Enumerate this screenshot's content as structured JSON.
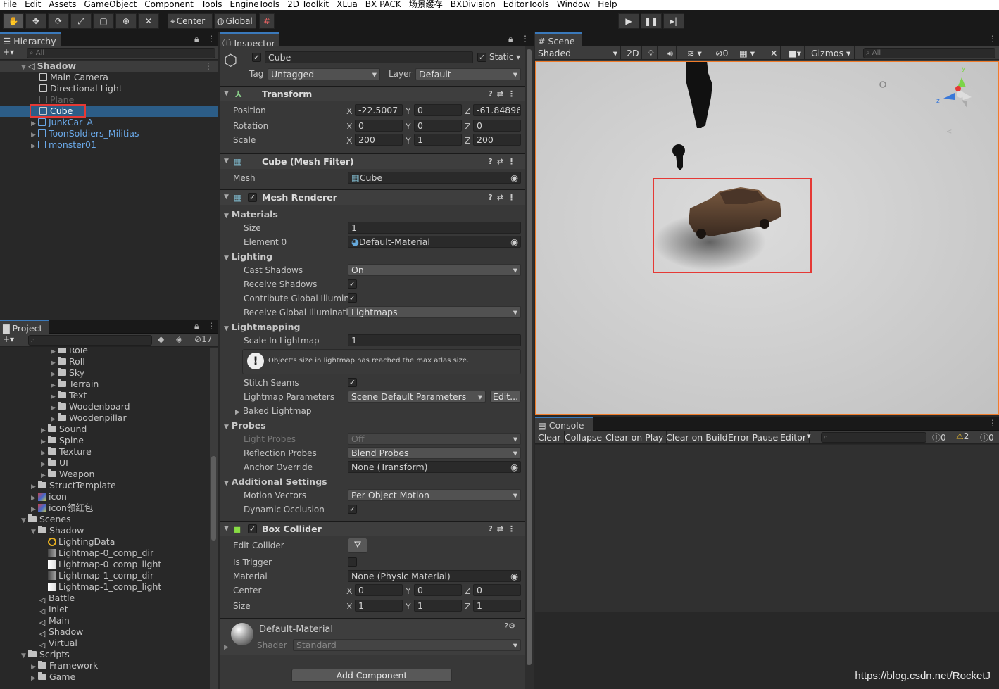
{
  "menubar": [
    "File",
    "Edit",
    "Assets",
    "GameObject",
    "Component",
    "Tools",
    "EngineTools",
    "2D Toolkit",
    "XLua",
    "BX PACK",
    "场景缓存",
    "BXDivision",
    "EditorTools",
    "Window",
    "Help"
  ],
  "toolbar": {
    "pivot_label": "Center",
    "space_label": "Global",
    "tool_icons": [
      "hand-icon",
      "move-icon",
      "rotate-icon",
      "scale-icon",
      "rect-icon",
      "transform-icon",
      "custom-tool-icon"
    ],
    "play_icons": [
      "play-icon",
      "pause-icon",
      "step-icon"
    ]
  },
  "hierarchy": {
    "tab": "Hierarchy",
    "search_placeholder": "All",
    "scene": "Shadow",
    "items": [
      {
        "label": "Main Camera",
        "state": "normal"
      },
      {
        "label": "Directional Light",
        "state": "normal"
      },
      {
        "label": "Plane",
        "state": "disabled"
      },
      {
        "label": "Cube",
        "state": "selected"
      },
      {
        "label": "JunkCar_A",
        "state": "prefab"
      },
      {
        "label": "ToonSoldiers_Militias",
        "state": "prefab"
      },
      {
        "label": "monster01",
        "state": "prefab"
      }
    ]
  },
  "project": {
    "tab": "Project",
    "hidden_count": "17",
    "items": [
      {
        "label": "Role",
        "indent": 3,
        "icon": "folder"
      },
      {
        "label": "Roll",
        "indent": 3,
        "icon": "folder"
      },
      {
        "label": "Sky",
        "indent": 3,
        "icon": "folder"
      },
      {
        "label": "Terrain",
        "indent": 3,
        "icon": "folder"
      },
      {
        "label": "Text",
        "indent": 3,
        "icon": "folder"
      },
      {
        "label": "Woodenboard",
        "indent": 3,
        "icon": "folder"
      },
      {
        "label": "Woodenpillar",
        "indent": 3,
        "icon": "folder"
      },
      {
        "label": "Sound",
        "indent": 2,
        "icon": "folder"
      },
      {
        "label": "Spine",
        "indent": 2,
        "icon": "folder"
      },
      {
        "label": "Texture",
        "indent": 2,
        "icon": "folder"
      },
      {
        "label": "UI",
        "indent": 2,
        "icon": "folder"
      },
      {
        "label": "Weapon",
        "indent": 2,
        "icon": "folder"
      },
      {
        "label": "StructTemplate",
        "indent": 1,
        "icon": "folder"
      },
      {
        "label": "icon",
        "indent": 1,
        "icon": "image"
      },
      {
        "label": "icon领红包",
        "indent": 1,
        "icon": "image"
      },
      {
        "label": "Scenes",
        "indent": 0,
        "icon": "folder",
        "open": true
      },
      {
        "label": "Shadow",
        "indent": 1,
        "icon": "folder",
        "open": true
      },
      {
        "label": "LightingData",
        "indent": 2,
        "icon": "lighting"
      },
      {
        "label": "Lightmap-0_comp_dir",
        "indent": 2,
        "icon": "texture"
      },
      {
        "label": "Lightmap-0_comp_light",
        "indent": 2,
        "icon": "texture"
      },
      {
        "label": "Lightmap-1_comp_dir",
        "indent": 2,
        "icon": "texture"
      },
      {
        "label": "Lightmap-1_comp_light",
        "indent": 2,
        "icon": "texture"
      },
      {
        "label": "Battle",
        "indent": 1,
        "icon": "scene"
      },
      {
        "label": "Inlet",
        "indent": 1,
        "icon": "scene"
      },
      {
        "label": "Main",
        "indent": 1,
        "icon": "scene"
      },
      {
        "label": "Shadow",
        "indent": 1,
        "icon": "scene"
      },
      {
        "label": "Virtual",
        "indent": 1,
        "icon": "scene"
      },
      {
        "label": "Scripts",
        "indent": 0,
        "icon": "folder",
        "open": true
      },
      {
        "label": "Framework",
        "indent": 1,
        "icon": "folder"
      },
      {
        "label": "Game",
        "indent": 1,
        "icon": "folder"
      }
    ]
  },
  "inspector": {
    "tab": "Inspector",
    "object_name": "Cube",
    "static_label": "Static",
    "tag_label": "Tag",
    "tag_value": "Untagged",
    "layer_label": "Layer",
    "layer_value": "Default",
    "transform": {
      "title": "Transform",
      "position_label": "Position",
      "position": [
        "-22.5007",
        "0",
        "-61.84896"
      ],
      "rotation_label": "Rotation",
      "rotation": [
        "0",
        "0",
        "0"
      ],
      "scale_label": "Scale",
      "scale": [
        "200",
        "1",
        "200"
      ]
    },
    "mesh_filter": {
      "title": "Cube (Mesh Filter)",
      "mesh_label": "Mesh",
      "mesh_value": "Cube"
    },
    "mesh_renderer": {
      "title": "Mesh Renderer",
      "materials": "Materials",
      "size_label": "Size",
      "size_value": "1",
      "element0_label": "Element 0",
      "element0_value": "Default-Material",
      "lighting": "Lighting",
      "cast_shadows_label": "Cast Shadows",
      "cast_shadows_value": "On",
      "receive_shadows_label": "Receive Shadows",
      "contribute_gi_label": "Contribute Global Illumina",
      "receive_gi_label": "Receive Global Illuminatio",
      "receive_gi_value": "Lightmaps",
      "lightmapping": "Lightmapping",
      "scale_in_lightmap_label": "Scale In Lightmap",
      "scale_in_lightmap_value": "1",
      "warning": "Object's size in lightmap has reached the max atlas size.",
      "stitch_seams_label": "Stitch Seams",
      "lightmap_params_label": "Lightmap Parameters",
      "lightmap_params_value": "Scene Default Parameters",
      "edit_button": "Edit...",
      "baked_lightmap": "Baked Lightmap",
      "probes": "Probes",
      "light_probes_label": "Light Probes",
      "light_probes_value": "Off",
      "reflection_probes_label": "Reflection Probes",
      "reflection_probes_value": "Blend Probes",
      "anchor_override_label": "Anchor Override",
      "anchor_override_value": "None (Transform)",
      "additional_settings": "Additional Settings",
      "motion_vectors_label": "Motion Vectors",
      "motion_vectors_value": "Per Object Motion",
      "dynamic_occlusion_label": "Dynamic Occlusion"
    },
    "box_collider": {
      "title": "Box Collider",
      "edit_collider_label": "Edit Collider",
      "is_trigger_label": "Is Trigger",
      "material_label": "Material",
      "material_value": "None (Physic Material)",
      "center_label": "Center",
      "center": [
        "0",
        "0",
        "0"
      ],
      "size_label": "Size",
      "size": [
        "1",
        "1",
        "1"
      ]
    },
    "material": {
      "name": "Default-Material",
      "shader_label": "Shader",
      "shader_value": "Standard"
    },
    "add_component": "Add Component",
    "axis": [
      "X",
      "Y",
      "Z"
    ]
  },
  "scene": {
    "tab": "Scene",
    "shading": "Shaded",
    "mode_2d": "2D",
    "hidden_count": "0",
    "gizmos": "Gizmos",
    "search_placeholder": "All",
    "gizmo_labels": [
      "y",
      "z"
    ],
    "colors": {
      "viewport": "#cfcfcf",
      "highlight": "#e53935",
      "border": "#f07c2a"
    }
  },
  "console": {
    "tab": "Console",
    "buttons": [
      "Clear",
      "Collapse",
      "Clear on Play",
      "Clear on Build",
      "Error Pause",
      "Editor"
    ],
    "counts": {
      "info": "0",
      "warning": "2",
      "error": "0"
    }
  },
  "watermark": "https://blog.csdn.net/RocketJ"
}
